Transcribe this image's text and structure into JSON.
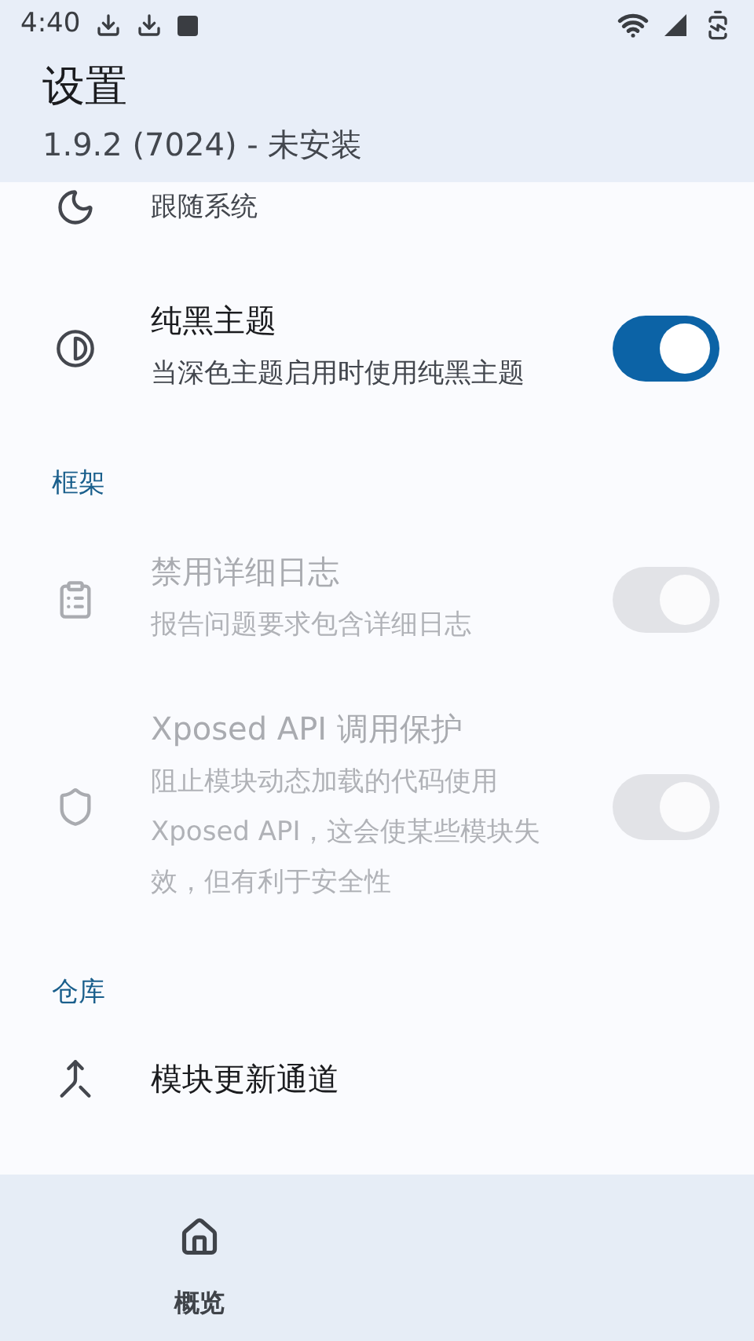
{
  "status_bar": {
    "time": "4:40"
  },
  "header": {
    "title": "设置",
    "subtitle": "1.9.2 (7024) - 未安装"
  },
  "sections": [
    {
      "items": [
        {
          "subtitle": "跟随系统"
        },
        {
          "title": "纯黑主题",
          "subtitle": "当深色主题启用时使用纯黑主题",
          "switch": {
            "checked": true,
            "disabled": false
          },
          "disabled": false
        }
      ]
    },
    {
      "heading": "框架",
      "items": [
        {
          "title": "禁用详细日志",
          "subtitle": "报告问题要求包含详细日志",
          "switch": {
            "checked": true,
            "disabled": true
          },
          "disabled": true
        },
        {
          "title": "Xposed API 调用保护",
          "subtitle": "阻止模块动态加载的代码使用 Xposed API，这会使某些模块失效，但有利于安全性",
          "switch": {
            "checked": true,
            "disabled": true
          },
          "disabled": true
        }
      ]
    },
    {
      "heading": "仓库",
      "items": [
        {
          "title": "模块更新通道",
          "disabled": false
        }
      ]
    }
  ],
  "nav": [
    {
      "label": "概览",
      "selected": false
    }
  ]
}
